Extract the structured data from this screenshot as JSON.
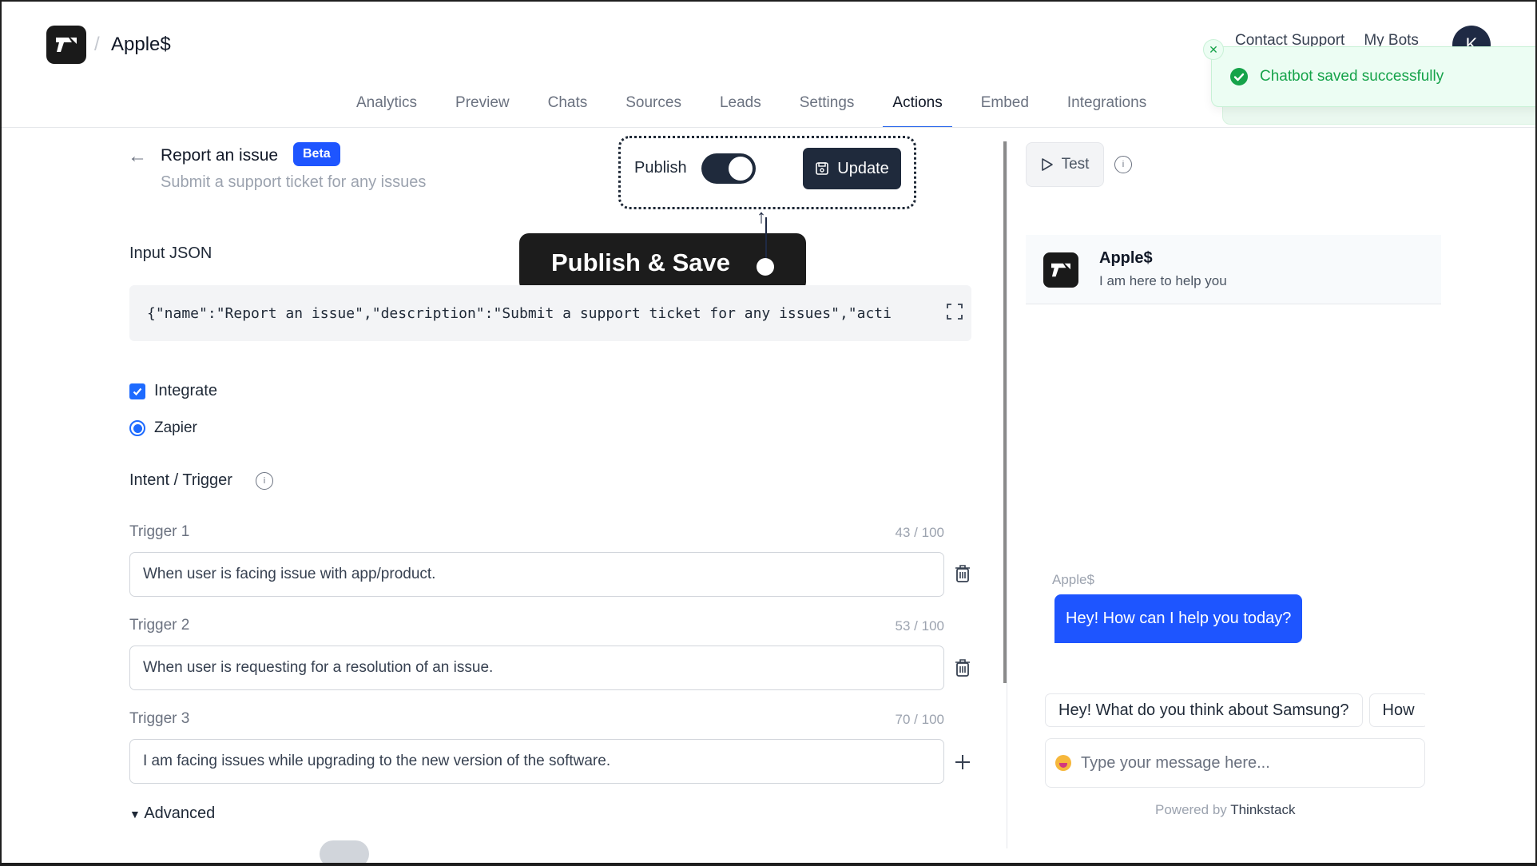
{
  "header": {
    "bot_name": "Apple$",
    "breadcrumb_separator": "/",
    "links": [
      "Contact Support",
      "My Bots"
    ],
    "avatar_initial": "K"
  },
  "tabs": [
    {
      "label": "Analytics",
      "active": false
    },
    {
      "label": "Preview",
      "active": false
    },
    {
      "label": "Chats",
      "active": false
    },
    {
      "label": "Sources",
      "active": false
    },
    {
      "label": "Leads",
      "active": false
    },
    {
      "label": "Settings",
      "active": false
    },
    {
      "label": "Actions",
      "active": true
    },
    {
      "label": "Embed",
      "active": false
    },
    {
      "label": "Integrations",
      "active": false
    }
  ],
  "toast": {
    "message": "Chatbot saved successfully",
    "status_color": "#16a34a"
  },
  "action": {
    "title": "Report an issue",
    "badge": "Beta",
    "description": "Submit a support ticket for any issues",
    "publish_label": "Publish",
    "publish_enabled": true,
    "update_label": "Update"
  },
  "callout": {
    "text": "Publish & Save"
  },
  "input_json": {
    "label": "Input JSON",
    "value": "{\"name\":\"Report an issue\",\"description\":\"Submit a support ticket for any issues\",\"acti"
  },
  "integrate": {
    "checkbox_label": "Integrate",
    "checked": true,
    "radio_label": "Zapier",
    "radio_selected": true
  },
  "intent": {
    "label": "Intent / Trigger",
    "triggers": [
      {
        "label": "Trigger 1",
        "count": "43 / 100",
        "value": "When user is facing issue with app/product.",
        "action_icon": "trash-icon"
      },
      {
        "label": "Trigger 2",
        "count": "53 / 100",
        "value": "When user is requesting for a resolution of an issue.",
        "action_icon": "trash-icon"
      },
      {
        "label": "Trigger 3",
        "count": "70 / 100",
        "value": "I am facing issues while upgrading to the new version of the software.",
        "action_icon": "plus-icon"
      }
    ]
  },
  "advanced": {
    "label": "Advanced"
  },
  "preview": {
    "test_label": "Test",
    "bot_name": "Apple$",
    "tagline": "I am here to help you",
    "sender_label": "Apple$",
    "greeting": "Hey! How can I help you today?",
    "suggestions": [
      "Hey! What do you think about Samsung?",
      "How"
    ],
    "message_placeholder": "Type your message here...",
    "powered_by_prefix": "Powered by",
    "powered_by_brand": "Thinkstack",
    "accent_color": "#1e55ff"
  }
}
